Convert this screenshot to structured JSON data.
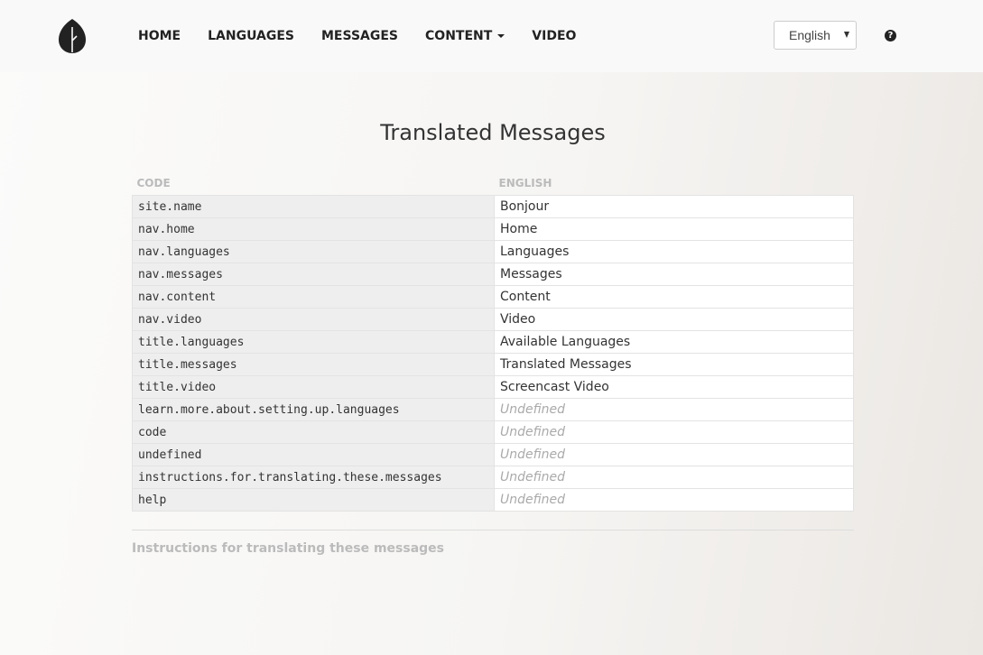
{
  "nav": {
    "items": [
      {
        "label": "HOME"
      },
      {
        "label": "LANGUAGES"
      },
      {
        "label": "MESSAGES"
      },
      {
        "label": "CONTENT",
        "dropdown": true
      },
      {
        "label": "VIDEO"
      }
    ],
    "language_select": {
      "value": "English"
    },
    "help_icon": "question-circle"
  },
  "main": {
    "title": "Translated Messages",
    "table": {
      "headers": [
        "CODE",
        "ENGLISH"
      ],
      "rows": [
        {
          "code": "site.name",
          "value": "Bonjour",
          "undefined": false
        },
        {
          "code": "nav.home",
          "value": "Home",
          "undefined": false
        },
        {
          "code": "nav.languages",
          "value": "Languages",
          "undefined": false
        },
        {
          "code": "nav.messages",
          "value": "Messages",
          "undefined": false
        },
        {
          "code": "nav.content",
          "value": "Content",
          "undefined": false
        },
        {
          "code": "nav.video",
          "value": "Video",
          "undefined": false
        },
        {
          "code": "title.languages",
          "value": "Available Languages",
          "undefined": false
        },
        {
          "code": "title.messages",
          "value": "Translated Messages",
          "undefined": false
        },
        {
          "code": "title.video",
          "value": "Screencast Video",
          "undefined": false
        },
        {
          "code": "learn.more.about.setting.up.languages",
          "value": "Undefined",
          "undefined": true
        },
        {
          "code": "code",
          "value": "Undefined",
          "undefined": true
        },
        {
          "code": "undefined",
          "value": "Undefined",
          "undefined": true
        },
        {
          "code": "instructions.for.translating.these.messages",
          "value": "Undefined",
          "undefined": true
        },
        {
          "code": "help",
          "value": "Undefined",
          "undefined": true
        }
      ]
    },
    "instructions_link": "Instructions for translating these messages"
  },
  "colors": {
    "undefined_text": "#aaaaaa",
    "header_text": "#bbbbbb",
    "code_cell_bg": "#eeeeee"
  }
}
